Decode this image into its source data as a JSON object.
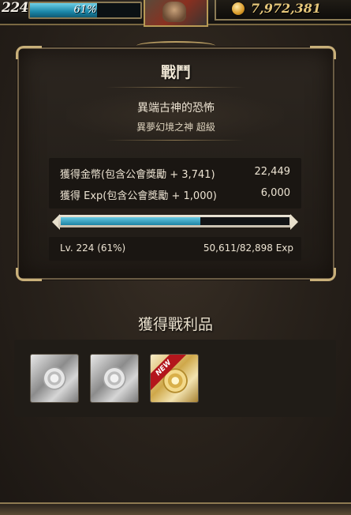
{
  "top_bar": {
    "level": "224",
    "exp_percent_label": "61%",
    "exp_fraction": 0.61,
    "gold_amount": "7,972,381"
  },
  "battle_panel": {
    "title": "戰鬥",
    "quest_name": "異端古神的恐怖",
    "quest_subtitle": "異夢幻境之神 超級",
    "rewards": [
      {
        "label": "獲得金幣(包含公會獎勵 + 3,741)",
        "value": "22,449"
      },
      {
        "label": "獲得 Exp(包含公會獎勵 + 1,000)",
        "value": "6,000"
      }
    ],
    "level_progress_fraction": 0.61,
    "level_label": "Lv. 224 (61%)",
    "exp_label": "50,611/82,898 Exp"
  },
  "spoils": {
    "title": "獲得戰利品",
    "items": [
      {
        "icon": "silver-medal-icon",
        "new": false
      },
      {
        "icon": "silver-medal-icon",
        "new": false
      },
      {
        "icon": "gold-medal-icon",
        "new": true,
        "badge": "NEW"
      }
    ]
  },
  "colors": {
    "exp_fill": "#1d84a5",
    "panel_border": "#6b5c44",
    "new_badge": "#b3161c",
    "gold_text": "#e6c77a"
  }
}
